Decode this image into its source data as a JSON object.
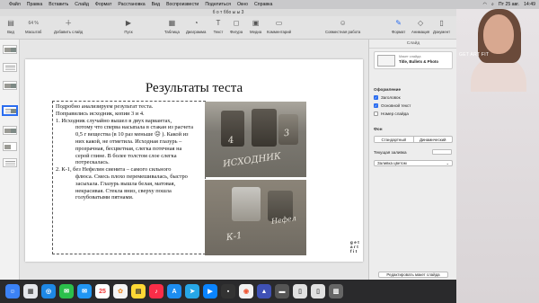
{
  "menubar": {
    "apple": "",
    "items": [
      "Файл",
      "Правка",
      "Вставить",
      "Слайд",
      "Формат",
      "Расстановка",
      "Вид",
      "Воспроизвести",
      "Поделиться",
      "Окно",
      "Справка"
    ],
    "date": "Пт 25 авг.",
    "time": "14:49"
  },
  "window": {
    "title": "б о т ббо ы ы 3"
  },
  "toolbar": {
    "items": [
      {
        "id": "view",
        "label": "Вид",
        "icon": "sidebar-icon"
      },
      {
        "id": "zoom",
        "label": "Масштаб",
        "value": "64 %",
        "icon": "zoom-icon"
      },
      {
        "id": "add-slide",
        "label": "Добавить слайд",
        "icon": "plus-icon"
      },
      {
        "id": "play",
        "label": "Пуск",
        "icon": "play-icon"
      },
      {
        "id": "table",
        "label": "Таблица",
        "icon": "table-icon"
      },
      {
        "id": "chart",
        "label": "Диаграмма",
        "icon": "chart-icon"
      },
      {
        "id": "text",
        "label": "Текст",
        "icon": "text-icon"
      },
      {
        "id": "shape",
        "label": "Фигура",
        "icon": "shape-icon"
      },
      {
        "id": "media",
        "label": "Медиа",
        "icon": "media-icon"
      },
      {
        "id": "comment",
        "label": "Комментарий",
        "icon": "comment-icon"
      },
      {
        "id": "collaborate",
        "label": "Совместная работа",
        "icon": "collaborate-icon"
      },
      {
        "id": "format",
        "label": "Формат",
        "icon": "format-icon"
      },
      {
        "id": "animate",
        "label": "Анимация",
        "icon": "animate-icon"
      },
      {
        "id": "document",
        "label": "Документ",
        "icon": "document-icon"
      }
    ]
  },
  "slide": {
    "title": "Результаты теста",
    "body": [
      "Подробно анализируем результат теста.",
      "Поправились исходник, копии 3 и 4.",
      "1.  Исходник случайно вышел в двух вариантах,",
      "потому что сперва насыпала в стакан из расчета",
      "0,5 г вещества (в 10 раз меньше ☹   ). Какой из",
      "них какой, не отметила. Исходная глазурь –",
      "прозрачная, бесцветная, слегка потечная на",
      "серой глине. В более толстом слое слегка",
      "потрескалась.",
      "2. К-1, без Нефелин сиенита – самого сильного",
      "флюса. Смесь плохо перемешивалась, быстро",
      "засыхала. Глазурь вышла белая, матовая,",
      "некрасивая. Стекла вниз, сверху пошла",
      "голубоватыми пятнами."
    ],
    "photo1_labels": [
      "ИСХОДНИК",
      "4",
      "3"
    ],
    "photo2_labels": [
      "Нефел",
      "К-1"
    ],
    "logo": "get\nart\nfit"
  },
  "inspector": {
    "header": "Слайд",
    "layout_caption": "Макет слайда",
    "layout_name": "Title, Bullets & Photo",
    "appearance_title": "Оформление",
    "checks": [
      {
        "label": "Заголовок",
        "on": true
      },
      {
        "label": "Основной текст",
        "on": true
      },
      {
        "label": "Номер слайда",
        "on": false
      }
    ],
    "bg_title": "Фон",
    "bg_options": [
      "Стандартный",
      "Динамический"
    ],
    "fill_label": "Текущая заливка",
    "fill_select": "Заливка цветом",
    "edit_button": "Редактировать макет слайда"
  },
  "dock": {
    "calendar_day": "25"
  },
  "camera": {
    "label": "GET ART FIT"
  },
  "colors": {
    "accent": "#2b6df0",
    "toolbar": "#e3e3e3",
    "slide_bg": "#ffffff"
  }
}
